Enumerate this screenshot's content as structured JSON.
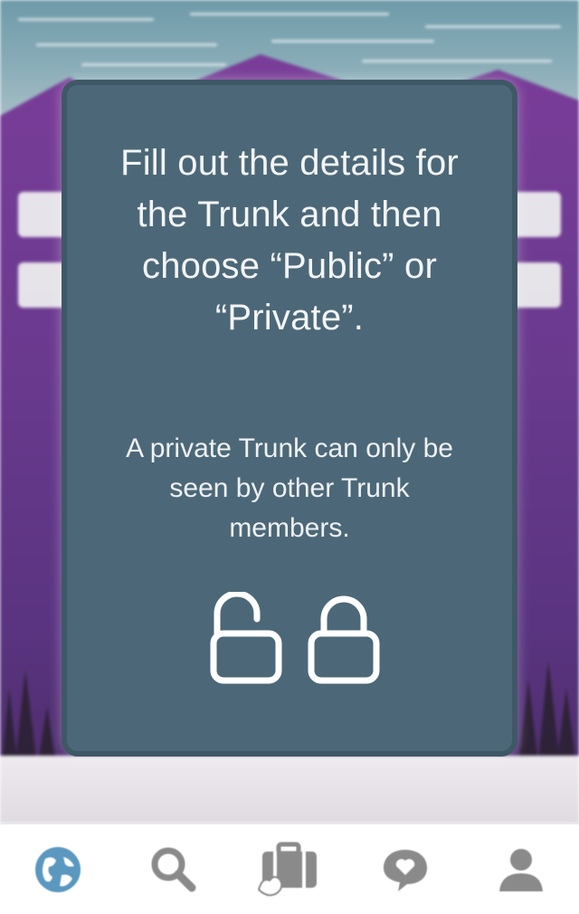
{
  "modal": {
    "title": "Fill out the details for the Trunk and then choose “Public” or “Private”.",
    "note": "A private Trunk can only be seen by other Trunk members.",
    "icons": [
      "unlocked-padlock-icon",
      "locked-padlock-icon"
    ]
  },
  "tabbar": {
    "tabs": [
      {
        "name": "globe-icon",
        "active": true
      },
      {
        "name": "search-icon",
        "active": false
      },
      {
        "name": "trunk-suitcase-icon",
        "active": false
      },
      {
        "name": "chat-heart-icon",
        "active": false
      },
      {
        "name": "profile-icon",
        "active": false
      }
    ]
  },
  "colors": {
    "card": "#4c6878",
    "card_border": "#3f5866",
    "card_text": "#f2f4f5",
    "tab_active": "#5a98c0",
    "tab_inactive": "#8a8a8a",
    "background_purple": "#6a3a8f"
  }
}
